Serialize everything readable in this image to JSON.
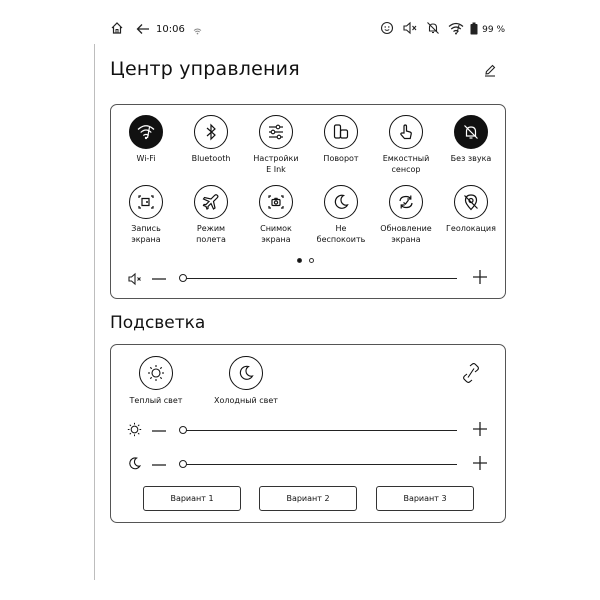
{
  "status": {
    "time": "10:06",
    "battery": "99 %",
    "left_icons": [
      "home-icon",
      "back-arrow-icon",
      "time-text",
      "wifi-small-icon"
    ],
    "right_icons": [
      "sync-face-icon",
      "speaker-mute-icon",
      "bell-off-icon",
      "wifi-icon",
      "battery-icon"
    ]
  },
  "control_center": {
    "title": "Центр управления",
    "edit_icon": "pencil-icon",
    "tiles": [
      {
        "label": "Wi-Fi",
        "icon": "wifi-icon",
        "active": true
      },
      {
        "label": "Bluetooth",
        "icon": "bluetooth-icon",
        "active": false
      },
      {
        "label": "Настройки\nE Ink",
        "icon": "sliders-icon",
        "active": false
      },
      {
        "label": "Поворот",
        "icon": "rotate-icon",
        "active": false
      },
      {
        "label": "Емкостный\nсенсор",
        "icon": "touch-icon",
        "active": false
      },
      {
        "label": "Без звука",
        "icon": "bell-off-icon",
        "active": true
      },
      {
        "label": "Запись\nэкрана",
        "icon": "screen-record-icon",
        "active": false
      },
      {
        "label": "Режим\nполета",
        "icon": "airplane-icon",
        "active": false
      },
      {
        "label": "Снимок\nэкрана",
        "icon": "screenshot-icon",
        "active": false
      },
      {
        "label": "Не\nбеспокоить",
        "icon": "moon-icon",
        "active": false
      },
      {
        "label": "Обновление\nэкрана",
        "icon": "refresh-icon",
        "active": false
      },
      {
        "label": "Геолокация",
        "icon": "location-off-icon",
        "active": false
      }
    ],
    "page_dots": {
      "count": 2,
      "active": 0
    },
    "volume": {
      "value": 0
    }
  },
  "backlight": {
    "title": "Подсветка",
    "warm": {
      "label": "Теплый свет",
      "icon": "sun-icon"
    },
    "cold": {
      "label": "Холодный свет",
      "icon": "moon-icon"
    },
    "link_icon": "link-icon",
    "warm_slider": {
      "value": 0
    },
    "cold_slider": {
      "value": 0
    },
    "variants": [
      "Вариант 1",
      "Вариант 2",
      "Вариант 3"
    ]
  }
}
